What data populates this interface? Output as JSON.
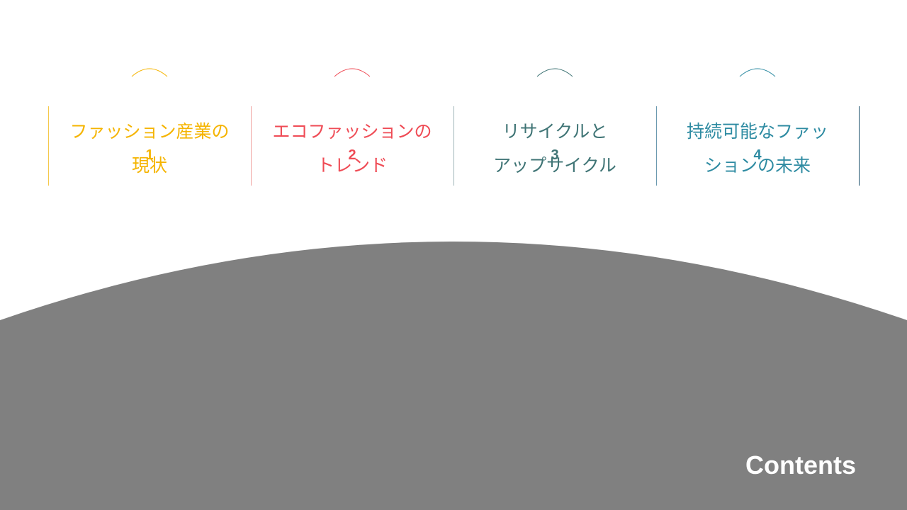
{
  "contents_label": "Contents",
  "items": [
    {
      "number": "1",
      "title_line1": "ファッション産業の",
      "title_line2": "現状",
      "color": "#f5b400",
      "divider_color": "#f5c94c"
    },
    {
      "number": "2",
      "title_line1": "エコファッションの",
      "title_line2": "トレンド",
      "color": "#ef4b55",
      "divider_color": "#f0a3a0"
    },
    {
      "number": "3",
      "title_line1": "リサイクルと",
      "title_line2": "アップサイクル",
      "color": "#3f7475",
      "divider_color": "#9fb4b8"
    },
    {
      "number": "4",
      "title_line1": "持続可能なファッ",
      "title_line2": "ションの未来",
      "color": "#2e8ba2",
      "divider_color": "#6c9ab0"
    }
  ],
  "colors": {
    "background": "#ffffff",
    "bottom_shape": "#808080",
    "end_divider": "#1b4f6b"
  }
}
